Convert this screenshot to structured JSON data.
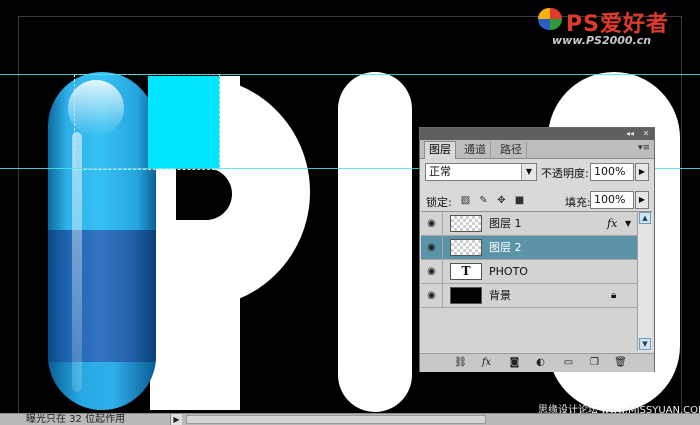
{
  "logo": {
    "text": "PS爱好者",
    "url": "www.PS2000.cn"
  },
  "watermark": "思缘设计论坛 www.MISSYUAN.COM",
  "statusbar": {
    "text": "曝光只在 32 位起作用",
    "arrow": "▶"
  },
  "colors": {
    "selected_layer": "#5b93a8",
    "guide": "#4fe3e8",
    "pill_top": "#35c0f2",
    "pill_bottom": "#2f6fbe",
    "cyan_fill": "#00e6ff"
  },
  "panel": {
    "titlebar": {
      "collapse": "◂◂",
      "close": "✕"
    },
    "tabs": [
      "图层",
      "通道",
      "路径"
    ],
    "active_tab": "图层",
    "tab_menu_icon": "menu-icon",
    "blend_mode": "正常",
    "opacity_label": "不透明度:",
    "opacity_value": "100%",
    "lock_label": "锁定:",
    "fill_label": "填充:",
    "fill_value": "100%",
    "lock_icons": [
      "lock-transparent-icon",
      "lock-image-icon",
      "lock-position-icon",
      "lock-all-icon"
    ],
    "layers": [
      {
        "name": "图层 1",
        "thumb": "transparent",
        "badge": "fx",
        "selected": false
      },
      {
        "name": "图层 2",
        "thumb": "transparent",
        "badge": "",
        "selected": true
      },
      {
        "name": "PHOTO",
        "thumb": "text",
        "thumb_label": "T",
        "badge": "",
        "selected": false
      },
      {
        "name": "背景",
        "thumb": "black",
        "badge": "lock",
        "selected": false
      }
    ],
    "bottom_icons": [
      "link-icon",
      "fx-icon",
      "mask-icon",
      "adjustment-icon",
      "folder-icon",
      "new-layer-icon",
      "trash-icon"
    ]
  }
}
